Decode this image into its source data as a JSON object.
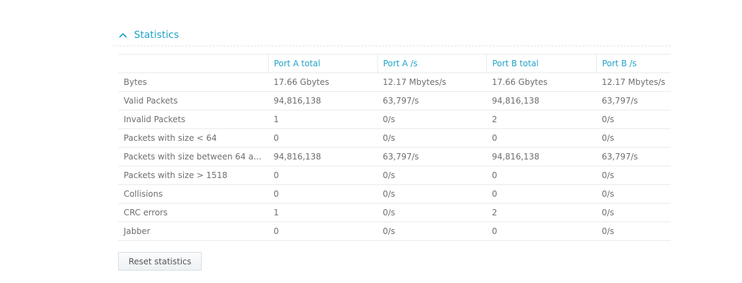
{
  "section": {
    "title": "Statistics",
    "toggle_icon": "chevron-up-icon"
  },
  "table": {
    "columns": [
      "",
      "Port A total",
      "Port A /s",
      "Port B total",
      "Port B /s"
    ],
    "rows": [
      {
        "label": "Bytes",
        "values": [
          "17.66 Gbytes",
          "12.17 Mbytes/s",
          "17.66 Gbytes",
          "12.17 Mbytes/s"
        ]
      },
      {
        "label": "Valid Packets",
        "values": [
          "94,816,138",
          "63,797/s",
          "94,816,138",
          "63,797/s"
        ]
      },
      {
        "label": "Invalid Packets",
        "values": [
          "1",
          "0/s",
          "2",
          "0/s"
        ]
      },
      {
        "label": "Packets with size < 64",
        "values": [
          "0",
          "0/s",
          "0",
          "0/s"
        ]
      },
      {
        "label": "Packets with size between 64 a...",
        "values": [
          "94,816,138",
          "63,797/s",
          "94,816,138",
          "63,797/s"
        ]
      },
      {
        "label": "Packets with size > 1518",
        "values": [
          "0",
          "0/s",
          "0",
          "0/s"
        ]
      },
      {
        "label": "Collisions",
        "values": [
          "0",
          "0/s",
          "0",
          "0/s"
        ]
      },
      {
        "label": "CRC errors",
        "values": [
          "1",
          "0/s",
          "2",
          "0/s"
        ]
      },
      {
        "label": "Jabber",
        "values": [
          "0",
          "0/s",
          "0",
          "0/s"
        ]
      }
    ]
  },
  "actions": {
    "reset_label": "Reset statistics"
  },
  "colors": {
    "accent": "#1ea3c8",
    "text": "#6e6e6e",
    "border": "#e7ecef"
  }
}
